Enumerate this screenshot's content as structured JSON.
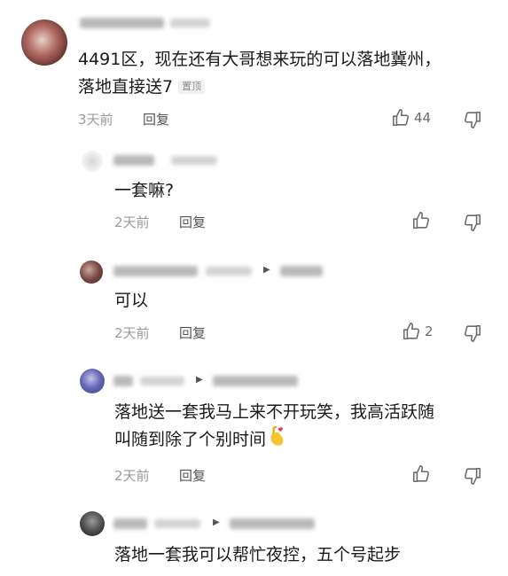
{
  "comments": [
    {
      "text_line1": "4491区，现在还有大哥想来玩的可以落地冀州，",
      "text_line2": "落地直接送7",
      "pinned_label": "置顶",
      "time": "3天前",
      "reply_label": "回复",
      "likes": "44"
    },
    {
      "text": "一套嘛?",
      "time": "2天前",
      "reply_label": "回复"
    },
    {
      "text": "可以",
      "time": "2天前",
      "reply_label": "回复",
      "likes": "2"
    },
    {
      "text_line1": "落地送一套我马上来不开玩笑，我高活跃随",
      "text_line2": "叫随到除了个别时间",
      "time": "2天前",
      "reply_label": "回复"
    },
    {
      "text": "落地一套我可以帮忙夜控，五个号起步"
    }
  ],
  "icons": {
    "like": "thumbs-up-icon",
    "dislike": "thumbs-down-icon",
    "emoji": "finger-heart-emoji",
    "reply_arrow": "reply-to-arrow-icon"
  },
  "colors": {
    "text": "#1a1a1a",
    "meta": "#9b9b9b",
    "icon": "#6b6b6b"
  }
}
